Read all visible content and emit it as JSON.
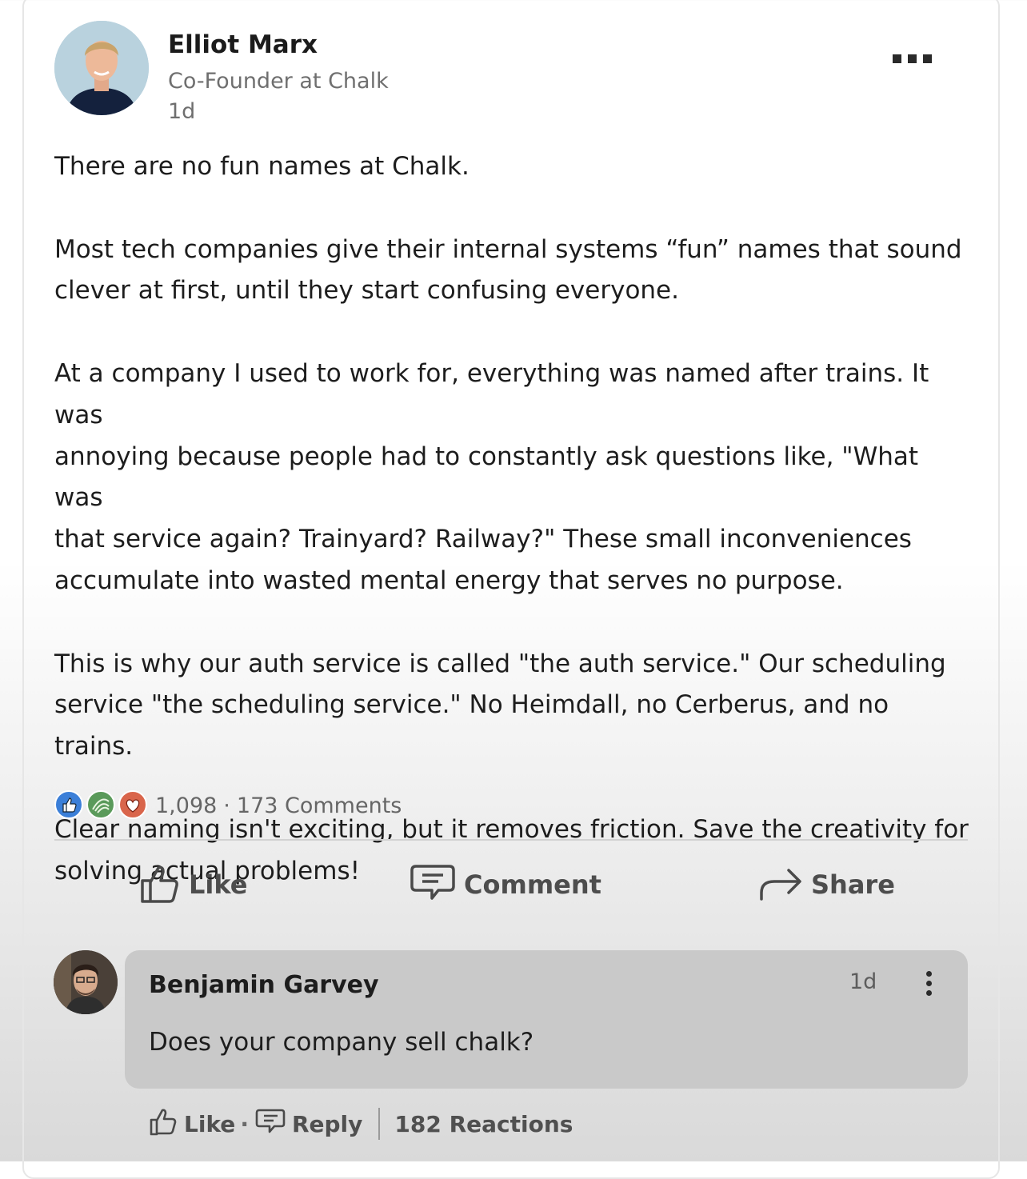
{
  "post": {
    "author_name": "Elliot Marx",
    "author_title": "Co-Founder at Chalk",
    "time": "1d",
    "paragraphs": [
      "There are no fun names at Chalk.",
      "Most tech companies give their internal systems “fun” names that sound\nclever at first, until they start confusing everyone.",
      "At a company I used to work for, everything was named after trains. It was\nannoying because people had to constantly ask questions like, \"What was\nthat service again? Trainyard? Railway?\" These small inconveniences\naccumulate into wasted mental energy that serves no purpose.",
      "This is why our auth service is called \"the auth service.\" Our scheduling\nservice \"the scheduling service.\" No Heimdall, no Cerberus, and no trains.",
      "Clear naming isn't exciting, but it removes friction. Save the creativity for\nsolving actual problems!"
    ],
    "reaction_count": "1,098",
    "comments_count": "173 Comments",
    "reaction_icons": [
      "like-reaction-icon",
      "insightful-reaction-icon",
      "love-reaction-icon"
    ]
  },
  "actions": {
    "like": "Like",
    "comment": "Comment",
    "share": "Share"
  },
  "comment": {
    "author_name": "Benjamin Garvey",
    "time": "1d",
    "text": "Does your company sell chalk?",
    "like_label": "Like",
    "reply_label": "Reply",
    "reactions_label": "182 Reactions"
  },
  "colors": {
    "like_blue": "#3b7fd8",
    "insightful_green": "#5a9a5a",
    "love_red": "#d9654b"
  }
}
